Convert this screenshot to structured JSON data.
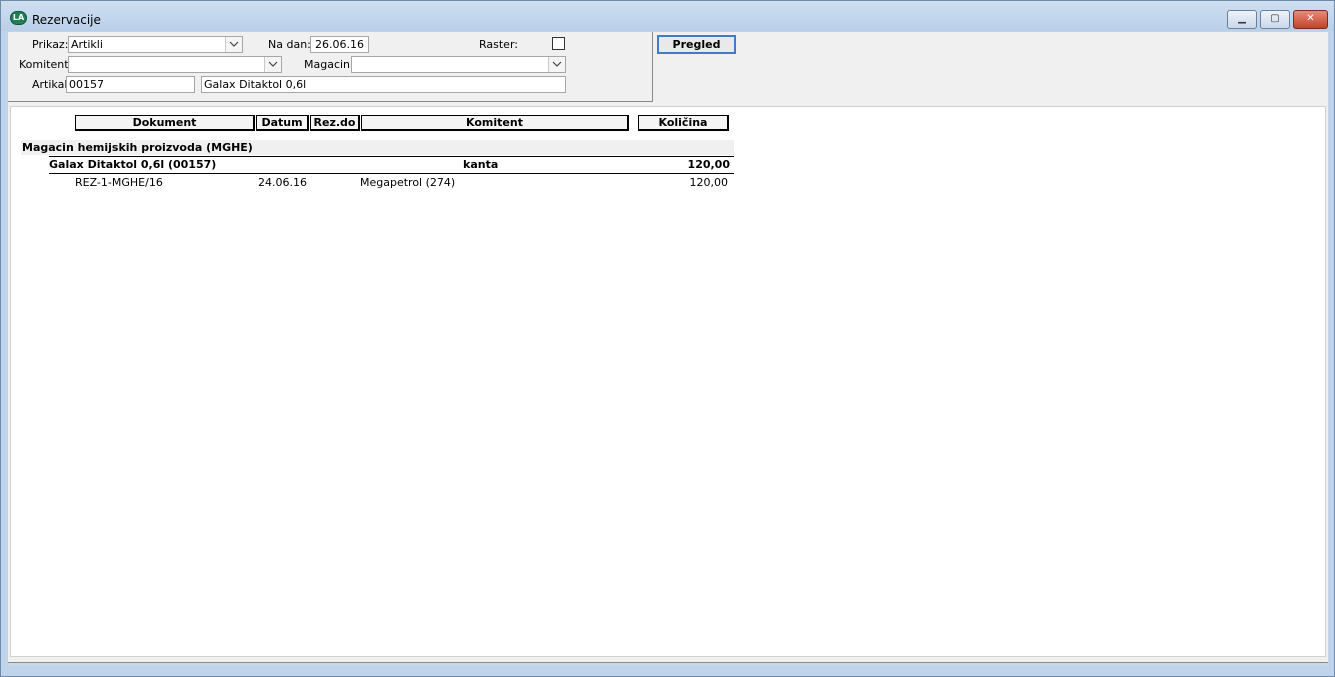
{
  "window": {
    "title": "Rezervacije",
    "icon_text": "LA",
    "controls": {
      "minimize": "▁",
      "maximize": "▢",
      "close": "✕"
    }
  },
  "filters": {
    "prikaz_label": "Prikaz:",
    "prikaz_value": "Artikli",
    "na_dan_label": "Na dan:",
    "na_dan_value": "26.06.16",
    "raster_label": "Raster:",
    "raster_checked": false,
    "komitent_label": "Komitent:",
    "komitent_value": "",
    "magacin_label": "Magacin:",
    "magacin_value": "",
    "artikal_label": "Artikal:",
    "artikal_code": "00157",
    "artikal_name": "Galax Ditaktol 0,6l"
  },
  "toolbar": {
    "pregled_label": "Pregled"
  },
  "report": {
    "columns": [
      "Dokument",
      "Datum",
      "Rez.do",
      "Komitent",
      "Količina"
    ],
    "group": {
      "title": "Magacin hemijskih proizvoda (MGHE)",
      "item": {
        "name": "Galax Ditaktol 0,6l (00157)",
        "unit": "kanta",
        "total": "120,00"
      },
      "rows": [
        {
          "dokument": "REZ-1-MGHE/16",
          "datum": "24.06.16",
          "rez_do": "",
          "komitent": "Megapetrol (274)",
          "kolicina": "120,00"
        }
      ]
    }
  },
  "colors": {
    "accent": "#3d7cc9",
    "titlebar": "#bfd3ea",
    "close": "#c2432c"
  }
}
